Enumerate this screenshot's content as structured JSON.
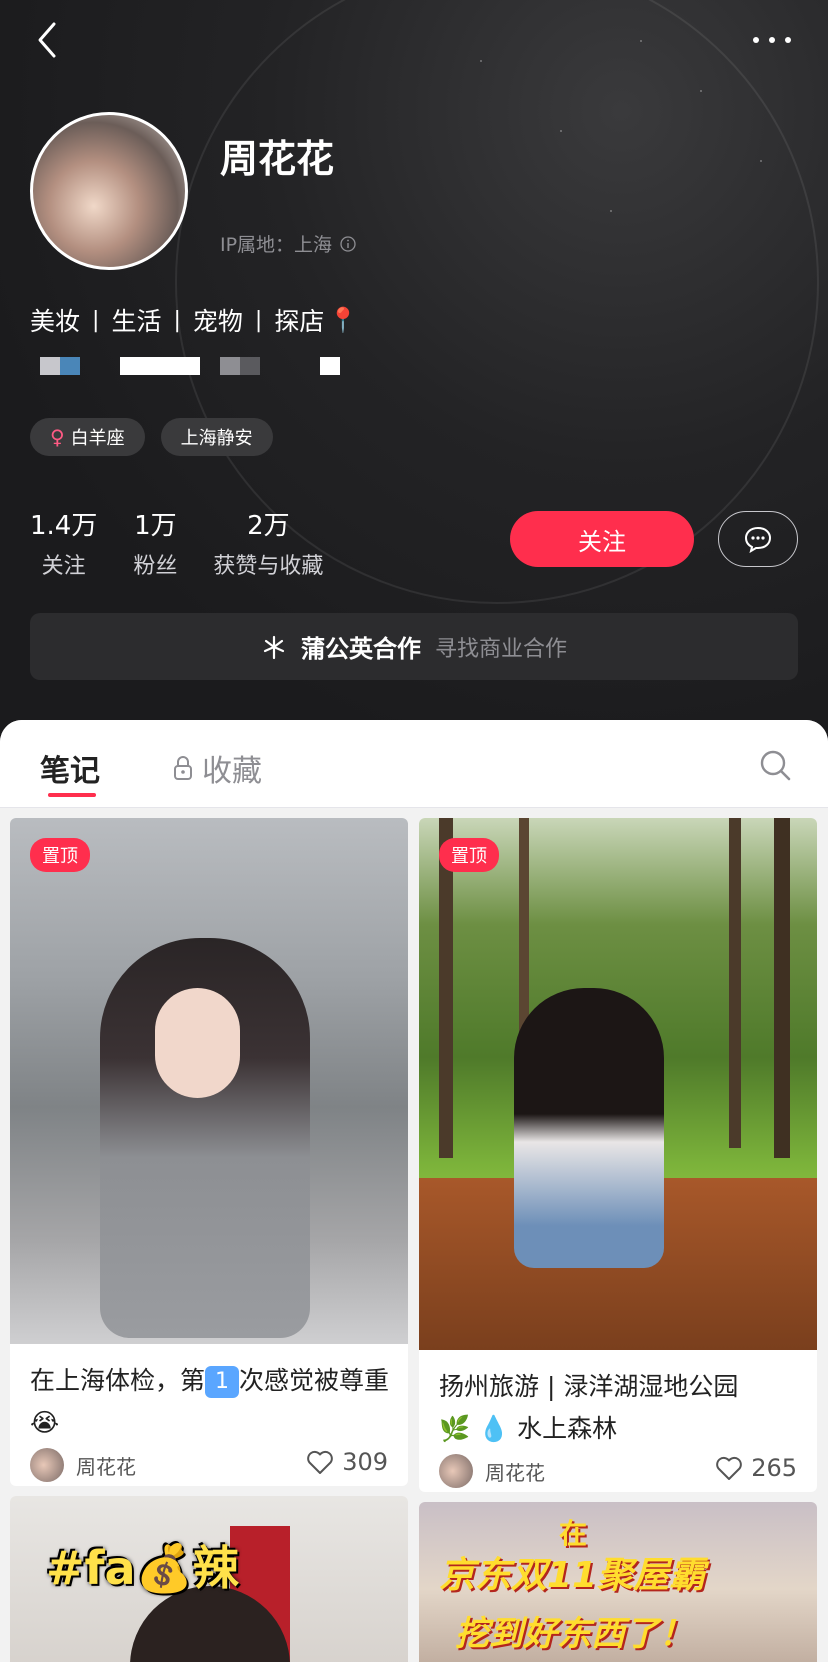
{
  "profile": {
    "name": "周花花",
    "ip_location": "IP属地：上海",
    "bio_items": [
      "美妆",
      "生活",
      "宠物",
      "探店"
    ],
    "bio_separator": "|",
    "tags": [
      {
        "icon": "female-icon",
        "symbol": "♀",
        "label": "白羊座"
      },
      {
        "label": "上海静安"
      }
    ]
  },
  "stats": [
    {
      "value": "1.4万",
      "label": "关注"
    },
    {
      "value": "1万",
      "label": "粉丝"
    },
    {
      "value": "2万",
      "label": "获赞与收藏"
    }
  ],
  "actions": {
    "follow_label": "关注",
    "chat_icon": "chat-bubble-icon"
  },
  "cooperation": {
    "title": "蒲公英合作",
    "subtitle": "寻找商业合作",
    "icon": "dandelion-icon"
  },
  "tabs": {
    "notes": "笔记",
    "favorites": "收藏",
    "favorites_icon": "lock-icon",
    "search_icon": "search-icon"
  },
  "notes": [
    {
      "pinned_label": "置顶",
      "title_part1": "在上海体检，第",
      "title_badge": "1️⃣",
      "title_part2": "次感觉被尊重😭",
      "author": "周花花",
      "likes": "309"
    },
    {
      "pinned_label": "置顶",
      "title_line1": "扬州旅游 | 渌洋湖湿地公园",
      "title_line2": "🌿 💧 水上森林",
      "author": "周花花",
      "likes": "265"
    },
    {
      "cover_text": "#fa💰辣"
    },
    {
      "cover_text_1": "在",
      "cover_text_2": "京东双11聚屋霸",
      "cover_text_3": "挖到好东西了！"
    }
  ],
  "colors": {
    "accent": "#ff2e4d",
    "header_bg": "#1c1c1e"
  }
}
